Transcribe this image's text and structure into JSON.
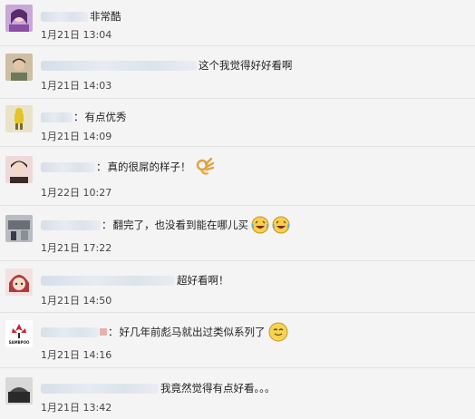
{
  "comments": [
    {
      "separator": "",
      "text": "非常酷",
      "time": "1月21日 13:04",
      "avatar_icon": "avatar-girl-purple-icon"
    },
    {
      "separator": "",
      "text": "这个我觉得好好看啊",
      "time": "1月21日 14:03",
      "avatar_icon": "avatar-person-icon"
    },
    {
      "separator": "：",
      "text": "有点优秀",
      "time": "1月21日 14:09",
      "avatar_icon": "avatar-yellow-figure-icon"
    },
    {
      "separator": "：",
      "text": "真的很屌的样子！",
      "time": "1月22日 10:27",
      "avatar_icon": "avatar-girl-icon",
      "emoji_icon": "ok-hand-emoji-icon"
    },
    {
      "separator": "：",
      "text": "翻完了，也没看到能在哪儿买",
      "time": "1月21日 17:22",
      "avatar_icon": "avatar-photo-icon",
      "emoji_icon": "laugh-cry-emoji-icon"
    },
    {
      "separator": "",
      "text": "超好看啊！",
      "time": "1月21日 14:50",
      "avatar_icon": "avatar-cartoon-girl-icon"
    },
    {
      "separator": "：",
      "text": "好几年前彪马就出过类似系列了",
      "time": "1月21日 14:16",
      "avatar_icon": "avatar-brand-logo-icon",
      "avatar_logo_text": "SAMBPOO",
      "emoji_icon": "smile-emoji-icon"
    },
    {
      "separator": "",
      "text": "我竟然觉得有点好看。。。",
      "time": "1月21日 13:42",
      "avatar_icon": "avatar-dark-photo-icon"
    }
  ],
  "colors": {
    "background": "#f4f4f4",
    "divider": "#e2e2e2",
    "text": "#222222",
    "time": "#444444"
  }
}
